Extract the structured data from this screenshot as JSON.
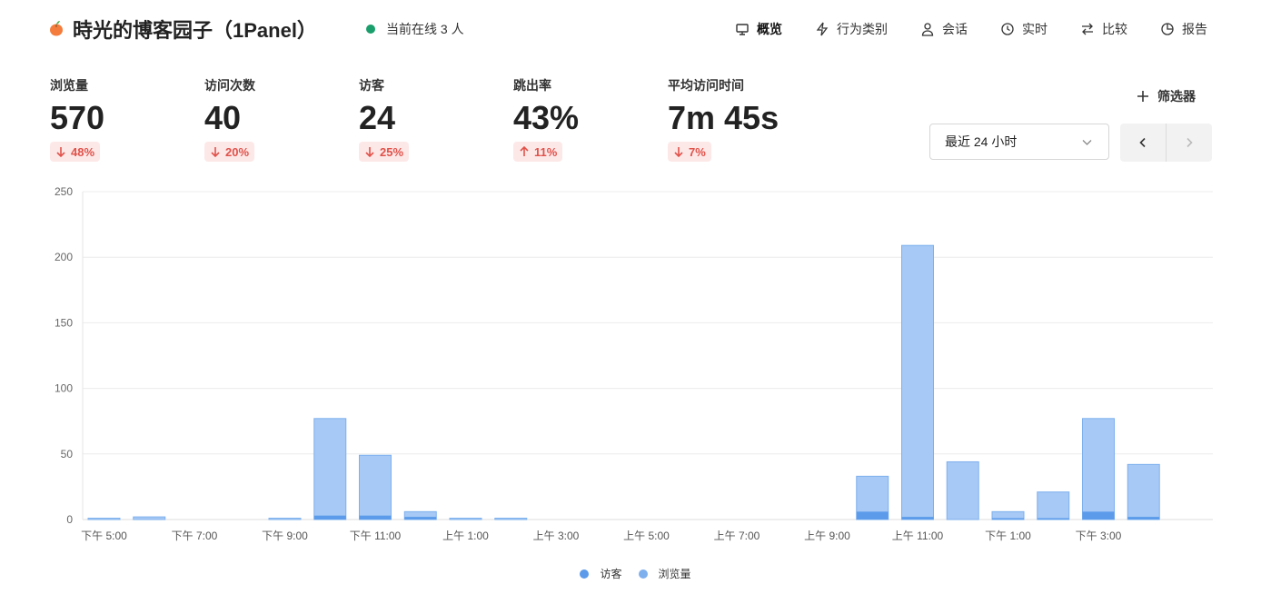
{
  "header": {
    "title": "時光的博客园子（1Panel）",
    "online_text": "当前在线 3 人",
    "nav": [
      {
        "label": "概览",
        "icon": "monitor-icon",
        "active": true
      },
      {
        "label": "行为类别",
        "icon": "lightning-icon",
        "active": false
      },
      {
        "label": "会话",
        "icon": "user-icon",
        "active": false
      },
      {
        "label": "实时",
        "icon": "clock-icon",
        "active": false
      },
      {
        "label": "比较",
        "icon": "swap-icon",
        "active": false
      },
      {
        "label": "报告",
        "icon": "pie-chart-icon",
        "active": false
      }
    ]
  },
  "metrics": [
    {
      "label": "浏览量",
      "value": "570",
      "change": "48%",
      "direction": "down"
    },
    {
      "label": "访问次数",
      "value": "40",
      "change": "20%",
      "direction": "down"
    },
    {
      "label": "访客",
      "value": "24",
      "change": "25%",
      "direction": "down"
    },
    {
      "label": "跳出率",
      "value": "43%",
      "change": "11%",
      "direction": "up"
    },
    {
      "label": "平均访问时间",
      "value": "7m 45s",
      "change": "7%",
      "direction": "down"
    }
  ],
  "controls": {
    "filter_label": "筛选器",
    "range_value": "最近 24 小时"
  },
  "colors": {
    "visitors": "#5b9bea",
    "pageviews": "#a6c9f5",
    "pageviews_border": "#7eb0ee",
    "change_bg": "#fde8e8",
    "change_fg": "#e0524a",
    "online_dot": "#1a9e6b"
  },
  "chart_data": {
    "type": "bar",
    "stacked": false,
    "ylim": [
      0,
      250
    ],
    "yticks": [
      0,
      50,
      100,
      150,
      200,
      250
    ],
    "x_tick_labels": [
      "下午 5:00",
      "下午 7:00",
      "下午 9:00",
      "下午 11:00",
      "上午 1:00",
      "上午 3:00",
      "上午 5:00",
      "上午 7:00",
      "上午 9:00",
      "上午 11:00",
      "下午 1:00",
      "下午 3:00"
    ],
    "x_tick_every": 2,
    "bar_count": 24,
    "series": [
      {
        "name": "访客",
        "values": [
          0,
          0,
          0,
          0,
          0,
          3,
          3,
          2,
          0,
          0,
          0,
          0,
          0,
          0,
          0,
          0,
          0,
          6,
          2,
          0,
          1,
          1,
          6,
          2
        ]
      },
      {
        "name": "浏览量",
        "values": [
          1,
          2,
          0,
          0,
          1,
          77,
          49,
          6,
          1,
          1,
          0,
          0,
          0,
          0,
          0,
          0,
          0,
          33,
          209,
          44,
          6,
          21,
          77,
          42
        ]
      }
    ],
    "grid": true,
    "legend": "bottom-center"
  }
}
